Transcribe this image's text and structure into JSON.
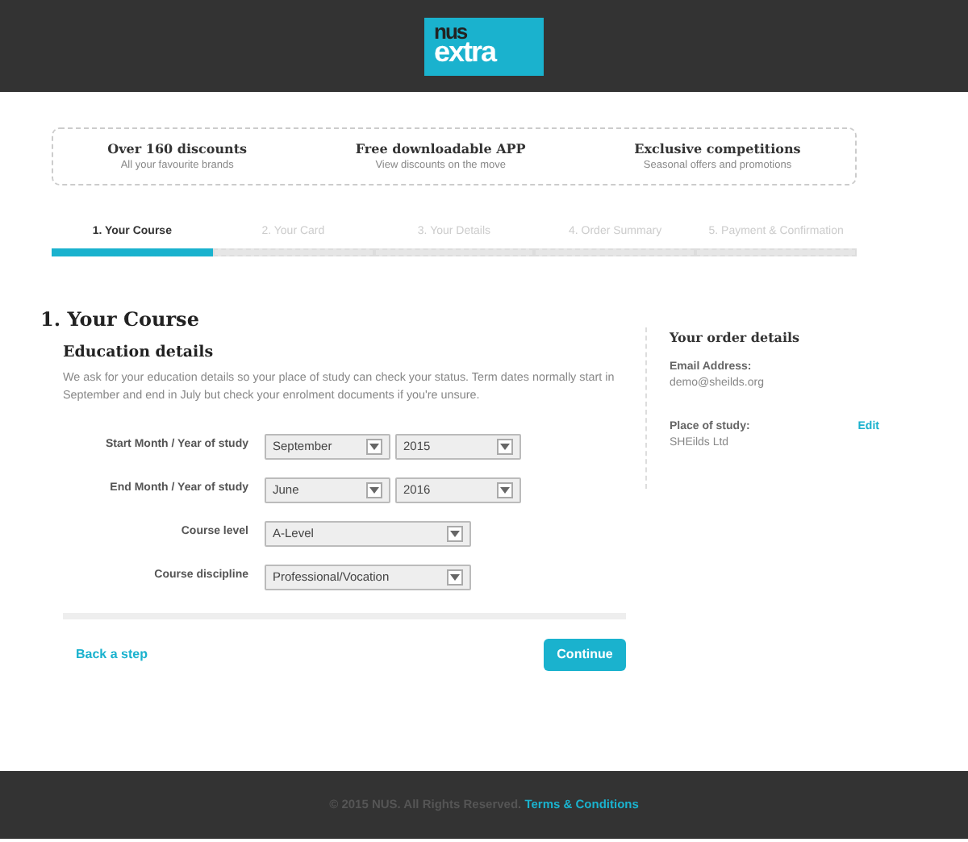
{
  "logo": {
    "top": "nus",
    "bottom": "extra"
  },
  "benefits": [
    {
      "title": "Over 160 discounts",
      "subtitle": "All your favourite brands"
    },
    {
      "title": "Free downloadable APP",
      "subtitle": "View discounts on the move"
    },
    {
      "title": "Exclusive competitions",
      "subtitle": "Seasonal offers and promotions"
    }
  ],
  "steps": [
    {
      "label": "1. Your Course",
      "selected": true
    },
    {
      "label": "2. Your Card",
      "selected": false
    },
    {
      "label": "3. Your Details",
      "selected": false
    },
    {
      "label": "4. Order Summary",
      "selected": false
    },
    {
      "label": "5. Payment & Confirmation",
      "selected": false
    }
  ],
  "heading": "1. Your Course",
  "section": {
    "title": "Education details",
    "description": "We ask for your education details so your place of study can check your status. Term dates normally start in September and end in July but check your enrolment documents if you're unsure."
  },
  "fields": [
    {
      "label": "Start Month / Year of study",
      "kind": "pair",
      "values": [
        "September",
        "2015"
      ]
    },
    {
      "label": "End Month / Year of study",
      "kind": "pair",
      "values": [
        "June",
        "2016"
      ]
    },
    {
      "label": "Course level",
      "kind": "single",
      "values": [
        "A-Level"
      ]
    },
    {
      "label": "Course discipline",
      "kind": "single",
      "values": [
        "Professional/Vocation"
      ]
    }
  ],
  "back_link": "Back a step",
  "continue_button": "Continue",
  "order": {
    "title": "Your order details",
    "items": [
      {
        "label": "Email Address:",
        "value": "demo@sheilds.org"
      },
      {
        "label": "Place of study:",
        "value": "SHEilds Ltd",
        "action": "Edit"
      }
    ]
  },
  "footer": {
    "text": "© 2015 NUS. All Rights Reserved.",
    "link": "Terms & Conditions"
  }
}
